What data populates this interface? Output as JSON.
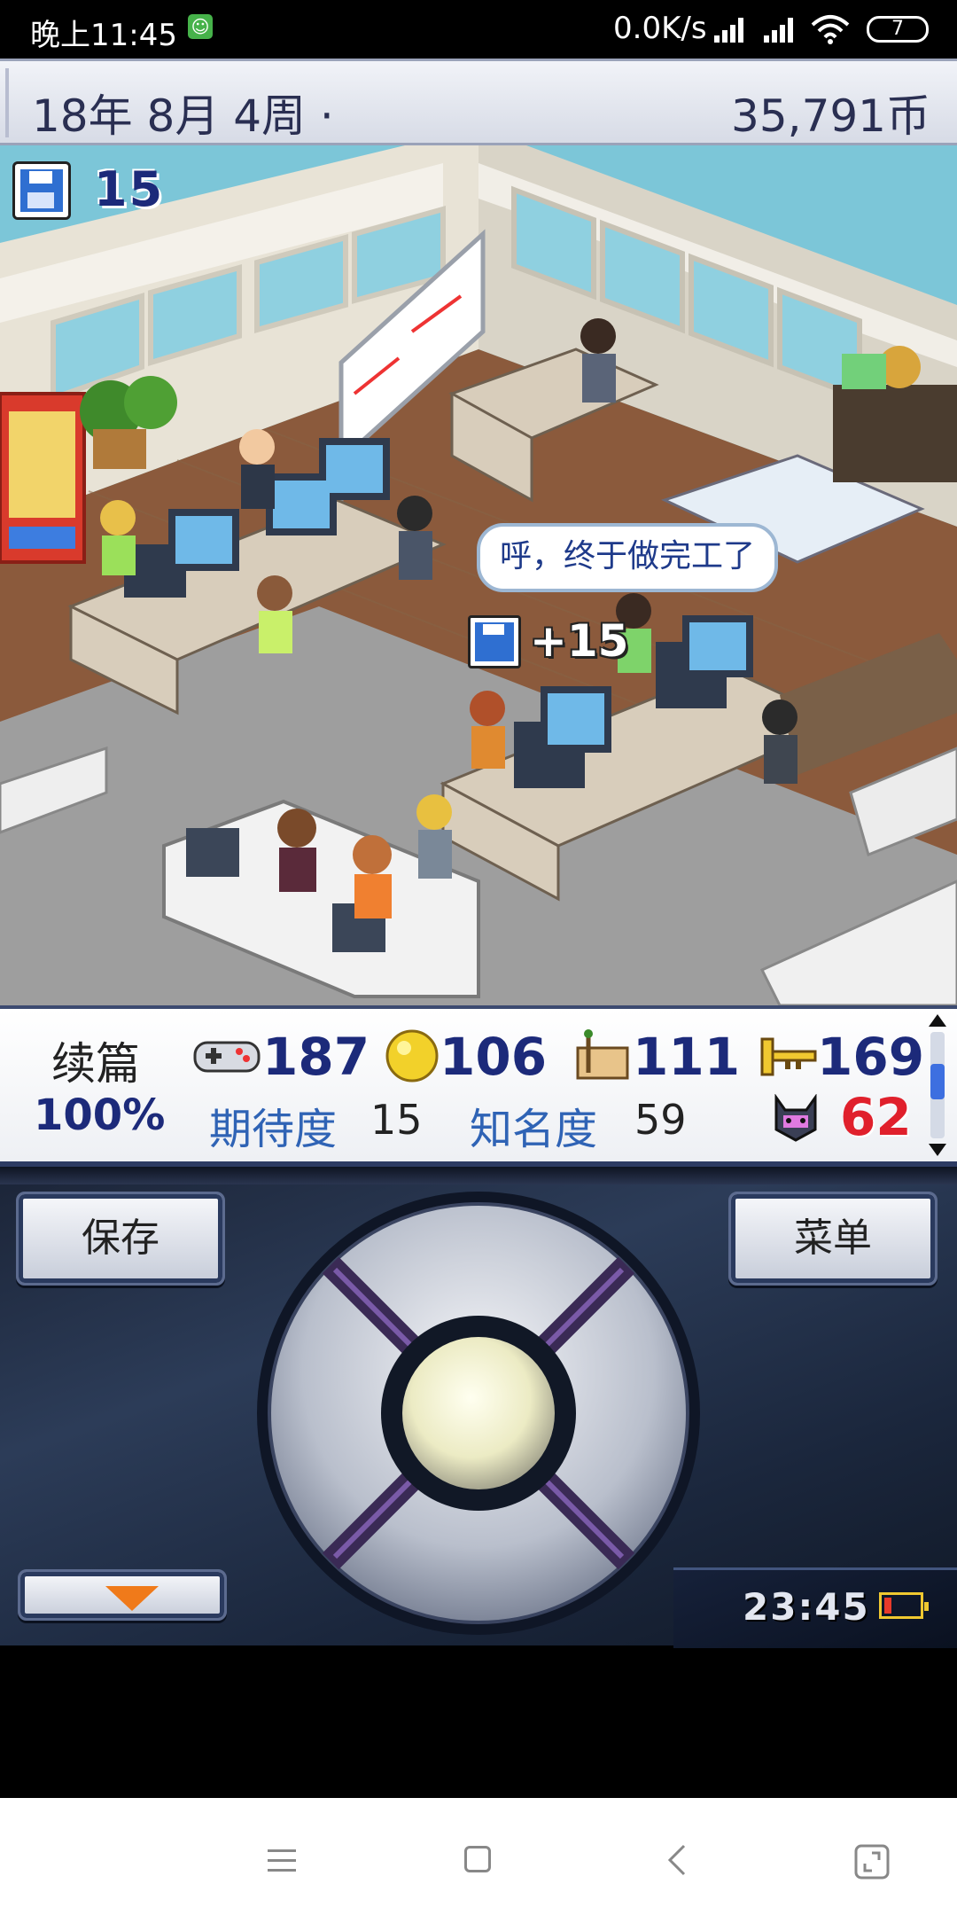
{
  "status_bar": {
    "time": "晚上11:45",
    "net_speed": "0.0K/s",
    "battery": "7"
  },
  "header": {
    "date": "18年 8月 4周 ·",
    "money": "35,791币"
  },
  "scene": {
    "save_count": "15",
    "speech_bubble": "呼，终于做完工了",
    "gain": "+15"
  },
  "stats": {
    "project_type": "续篇",
    "progress": "100%",
    "fun": "187",
    "creativity": "106",
    "graphics": "111",
    "sound": "169",
    "expectation_label": "期待度",
    "expectation_value": "15",
    "fame_label": "知名度",
    "fame_value": "59",
    "bugs": "62"
  },
  "controller": {
    "save_label": "保存",
    "menu_label": "菜单",
    "clock": "23:45"
  },
  "icons": {
    "save": "floppy-disk-icon",
    "fun": "gamepad-icon",
    "creativity": "gold-orb-icon",
    "graphics": "paintbrush-icon",
    "sound": "trumpet-icon",
    "bug": "bug-monster-icon"
  },
  "colors": {
    "header_text": "#2a2f52",
    "stat_navy": "#1c2a7a",
    "stat_blue": "#2f63b5",
    "bug_red": "#e0202c"
  }
}
